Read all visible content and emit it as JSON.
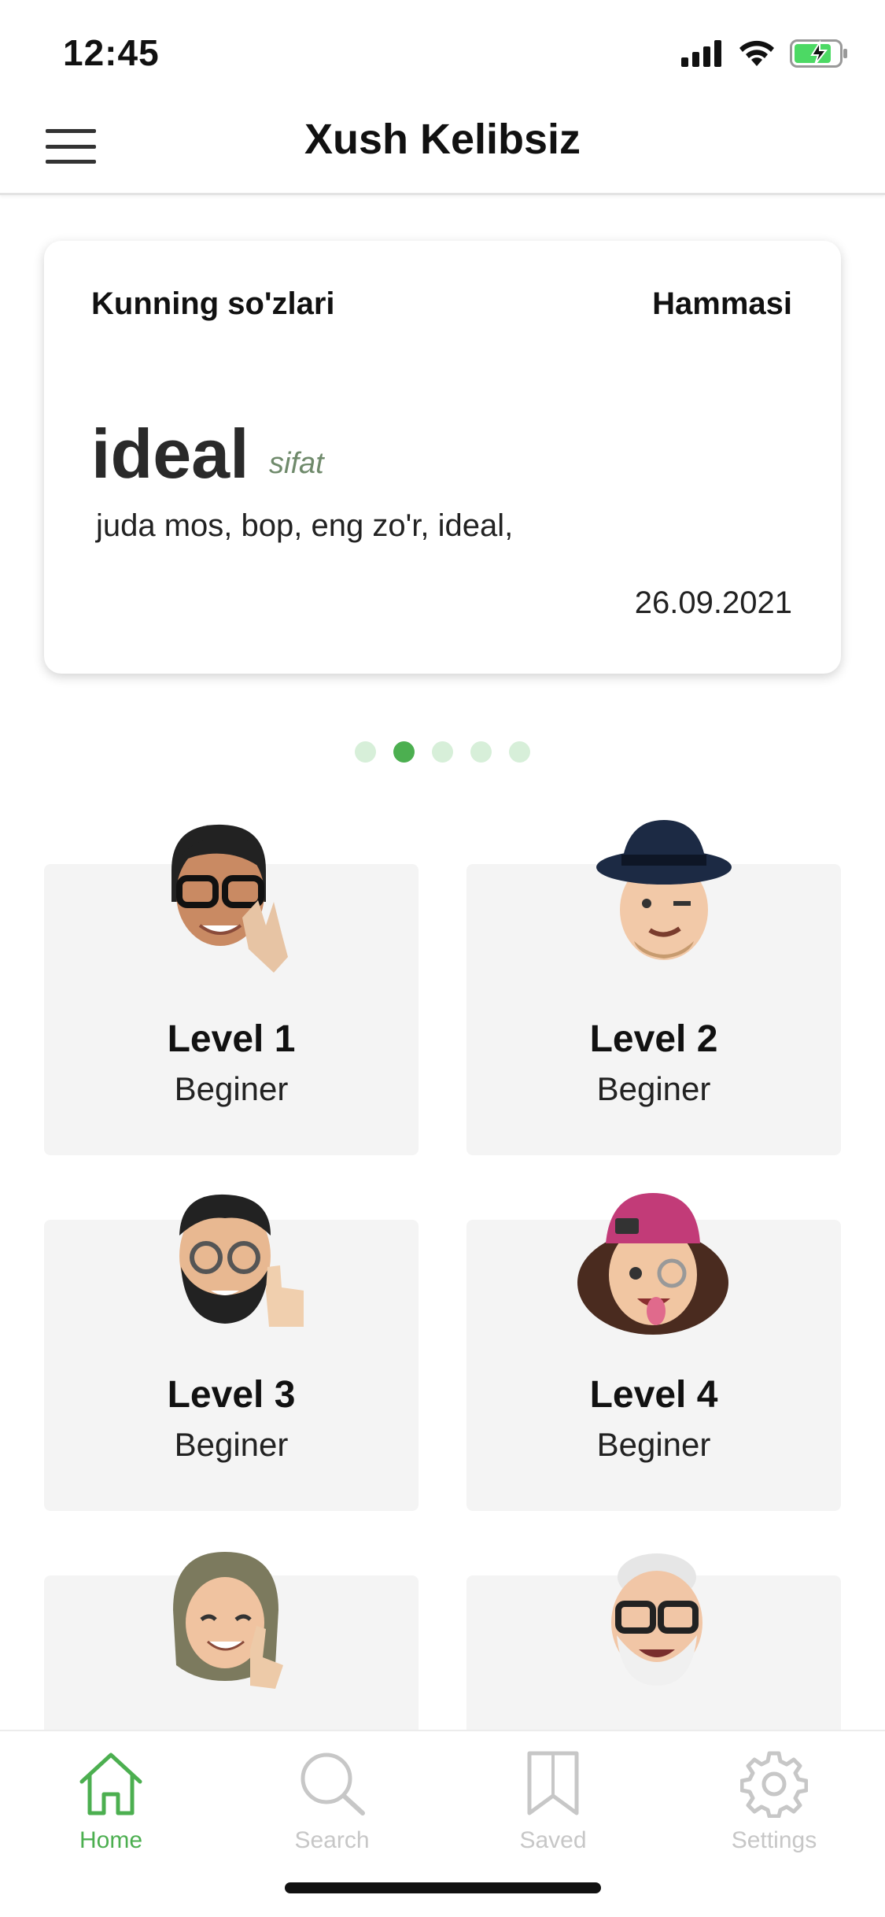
{
  "status": {
    "time": "12:45"
  },
  "header": {
    "title": "Xush Kelibsiz"
  },
  "word_card": {
    "label": "Kunning so'zlari",
    "all_link": "Hammasi",
    "word": "ideal",
    "part_of_speech": "sifat",
    "meaning": "juda mos, bop, eng zo'r, ideal,",
    "date": "26.09.2021"
  },
  "pager": {
    "count": 5,
    "active_index": 1
  },
  "levels": [
    {
      "title": "Level 1",
      "subtitle": "Beginer"
    },
    {
      "title": "Level 2",
      "subtitle": "Beginer"
    },
    {
      "title": "Level 3",
      "subtitle": "Beginer"
    },
    {
      "title": "Level 4",
      "subtitle": "Beginer"
    }
  ],
  "tabs": [
    {
      "label": "Home",
      "icon": "home-icon",
      "active": true
    },
    {
      "label": "Search",
      "icon": "search-icon",
      "active": false
    },
    {
      "label": "Saved",
      "icon": "bookmark-icon",
      "active": false
    },
    {
      "label": "Settings",
      "icon": "gear-icon",
      "active": false
    }
  ],
  "colors": {
    "accent": "#4caf50",
    "inactive": "#c7c7c7",
    "card_bg": "#f4f4f4",
    "battery": "#4cd964"
  }
}
